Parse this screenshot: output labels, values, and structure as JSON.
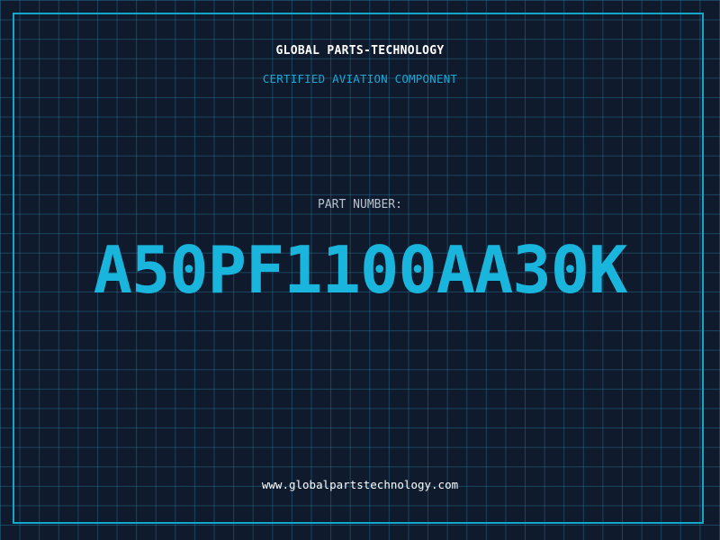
{
  "brand": {
    "name": "GLOBAL PARTS-TECHNOLOGY",
    "tagline": "CERTIFIED AVIATION COMPONENT"
  },
  "part": {
    "label": "PART NUMBER:",
    "number": "A50PF1100AA30K"
  },
  "footer": {
    "website": "www.globalpartstechnology.com"
  },
  "colors": {
    "background": "#0f1a2c",
    "accent": "#1ab5dc",
    "grid": "#28789f",
    "border": "#12a6c9"
  }
}
